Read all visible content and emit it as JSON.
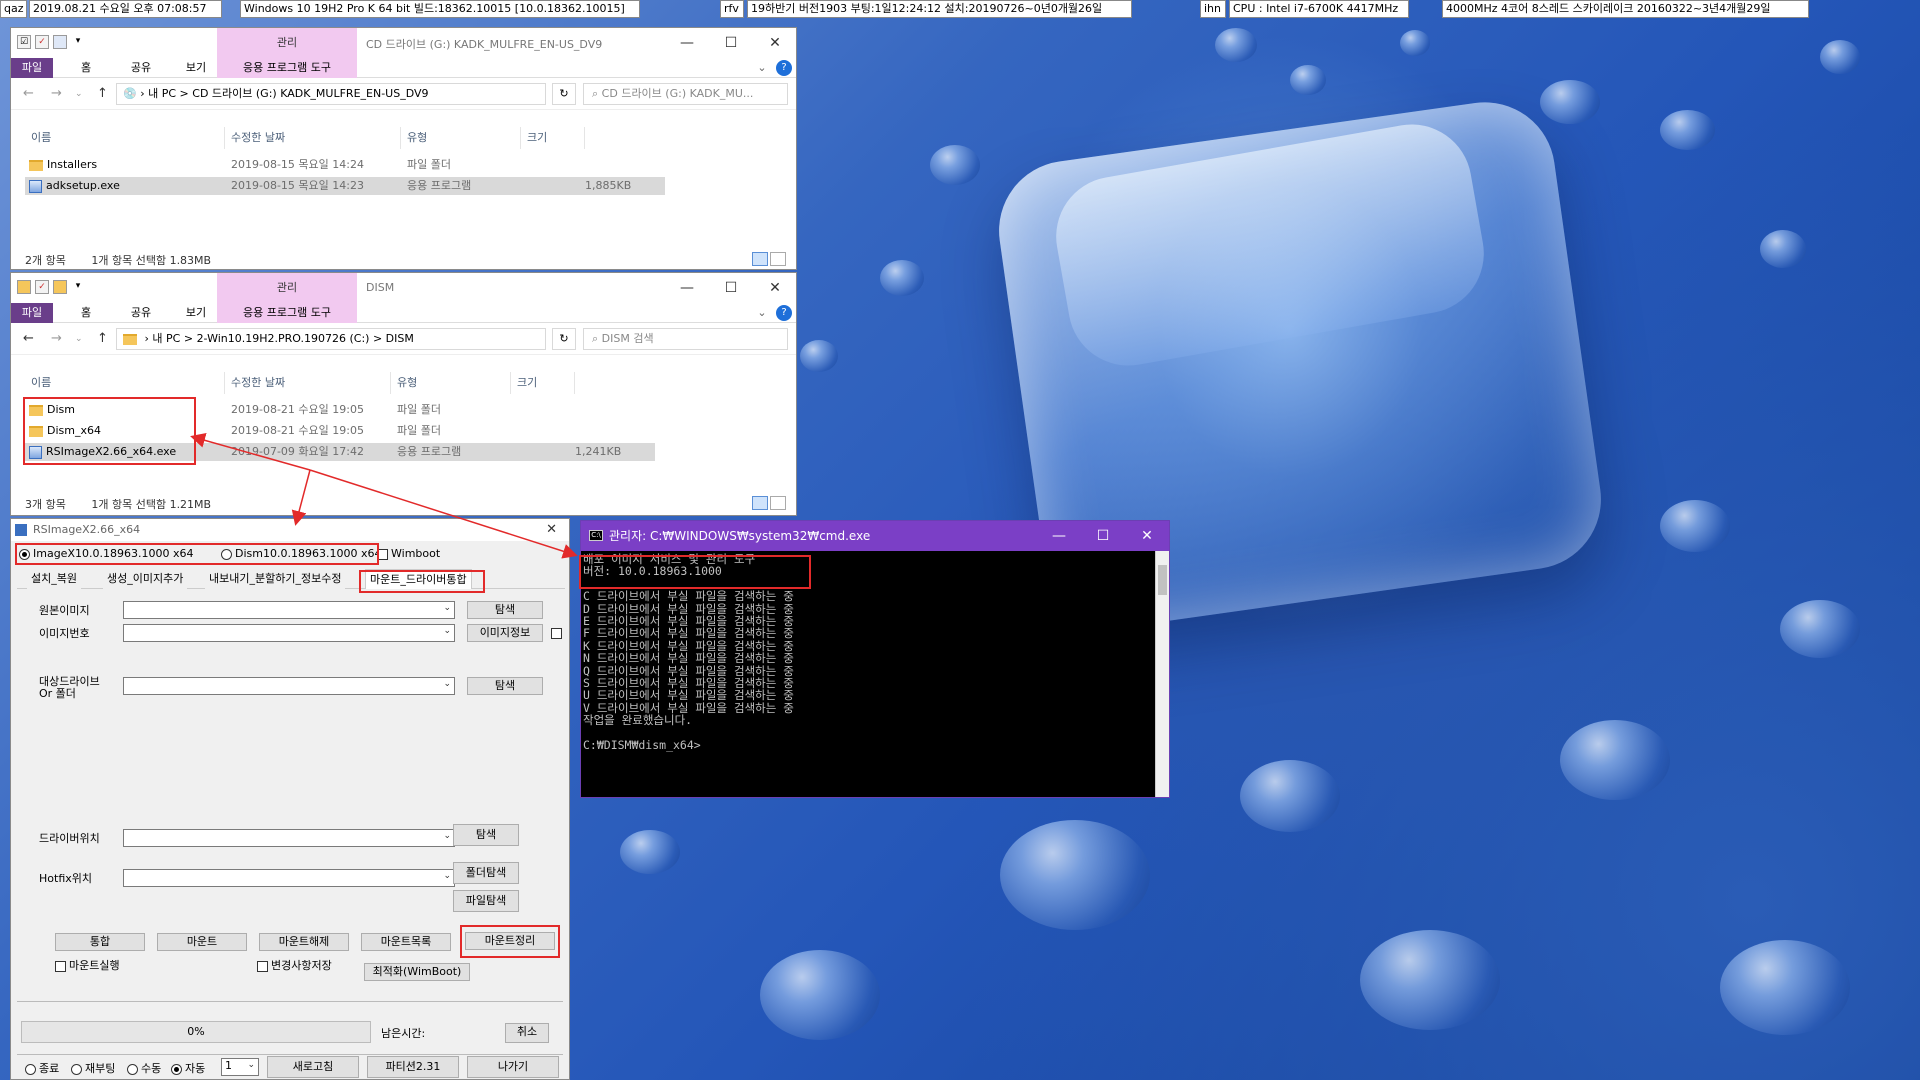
{
  "topbar": {
    "items": [
      "qaz",
      "2019.08.21 수요일 오후 07:08:57",
      "Windows 10 19H2 Pro K 64 bit 빌드:18362.10015 [10.0.18362.10015]",
      "rfv",
      "19하반기 버전1903 부팅:1일12:24:12 설치:20190726~0년0개월26일",
      "ihn",
      "CPU : Intel i7-6700K 4417MHz",
      "4000MHz 4코어 8스레드 스카이레이크 20160322~3년4개월29일"
    ]
  },
  "explorer1": {
    "title": "CD 드라이브 (G:) KADK_MULFRE_EN-US_DV9",
    "manage": "관리",
    "tabs": [
      "파일",
      "홈",
      "공유",
      "보기",
      "응용 프로그램 도구"
    ],
    "path": [
      "내 PC",
      ">",
      "CD 드라이브 (G:) KADK_MULFRE_EN-US_DV9"
    ],
    "search": "CD 드라이브 (G:) KADK_MU...",
    "columns": [
      "이름",
      "수정한 날짜",
      "유형",
      "크기"
    ],
    "rows": [
      {
        "name": "Installers",
        "date": "2019-08-15 목요일 14:24",
        "type": "파일 폴더",
        "size": ""
      },
      {
        "name": "adksetup.exe",
        "date": "2019-08-15 목요일 14:23",
        "type": "응용 프로그램",
        "size": "1,885KB"
      }
    ],
    "status": "2개 항목",
    "status2": "1개 항목 선택함 1.83MB"
  },
  "explorer2": {
    "title": "DISM",
    "manage": "관리",
    "tabs": [
      "파일",
      "홈",
      "공유",
      "보기",
      "응용 프로그램 도구"
    ],
    "path": [
      "내 PC",
      ">",
      "2-Win10.19H2.PRO.190726 (C:)",
      ">",
      "DISM"
    ],
    "search": "DISM 검색",
    "columns": [
      "이름",
      "수정한 날짜",
      "유형",
      "크기"
    ],
    "rows": [
      {
        "name": "Dism",
        "date": "2019-08-21 수요일 19:05",
        "type": "파일 폴더",
        "size": ""
      },
      {
        "name": "Dism_x64",
        "date": "2019-08-21 수요일 19:05",
        "type": "파일 폴더",
        "size": ""
      },
      {
        "name": "RSImageX2.66_x64.exe",
        "date": "2019-07-09 화요일 17:42",
        "type": "응용 프로그램",
        "size": "1,241KB"
      }
    ],
    "status": "3개 항목",
    "status2": "1개 항목 선택함 1.21MB"
  },
  "rsimagex": {
    "title": "RSImageX2.66_x64",
    "radio1": "ImageX10.0.18963.1000 x64",
    "radio2": "Dism10.0.18963.1000 x64",
    "wimboot": "Wimboot",
    "tabs": [
      "설치_복원",
      "생성_이미지추가",
      "내보내기_분할하기_정보수정",
      "마운트_드라이버통합"
    ],
    "src_label": "원본이미지",
    "idx_label": "이미지번호",
    "target_label1": "대상드라이브",
    "target_label2": "Or 폴더",
    "driver_label": "드라이버위치",
    "hotfix_label": "Hotfix위치",
    "browse": "탐색",
    "imginfo": "이미지정보",
    "folder_browse": "폴더탐색",
    "file_browse": "파일탐색",
    "actions": [
      "통합",
      "마운트",
      "마운트해제",
      "마운트목록",
      "마운트정리"
    ],
    "mount_run": "마운트실행",
    "save_changes": "변경사항저장",
    "optimize": "최적화(WimBoot)",
    "progress": "0%",
    "progress_value": 0,
    "remaining": "남은시간:",
    "cancel": "취소",
    "power": [
      "종료",
      "재부팅",
      "수동",
      "자동"
    ],
    "count": "1",
    "refresh": "새로고침",
    "partition": "파티션2.31",
    "exit": "나가기"
  },
  "cmd": {
    "title": "관리자: C:₩WINDOWS₩system32₩cmd.exe",
    "lines": [
      "배포 이미지 서비스 및 관리 도구",
      "버전: 10.0.18963.1000",
      "",
      "C 드라이브에서 부실 파일을 검색하는 중",
      "D 드라이브에서 부실 파일을 검색하는 중",
      "E 드라이브에서 부실 파일을 검색하는 중",
      "F 드라이브에서 부실 파일을 검색하는 중",
      "K 드라이브에서 부실 파일을 검색하는 중",
      "N 드라이브에서 부실 파일을 검색하는 중",
      "Q 드라이브에서 부실 파일을 검색하는 중",
      "S 드라이브에서 부실 파일을 검색하는 중",
      "U 드라이브에서 부실 파일을 검색하는 중",
      "V 드라이브에서 부실 파일을 검색하는 중",
      "작업을 완료했습니다.",
      "",
      "C:₩DISM₩dism_x64>"
    ]
  },
  "colors": {
    "accent_purple": "#7b3fc6",
    "ribbon_file": "#6a3e8a",
    "manage_pink": "#f2c9f0",
    "annotation_red": "#e22a2a"
  }
}
